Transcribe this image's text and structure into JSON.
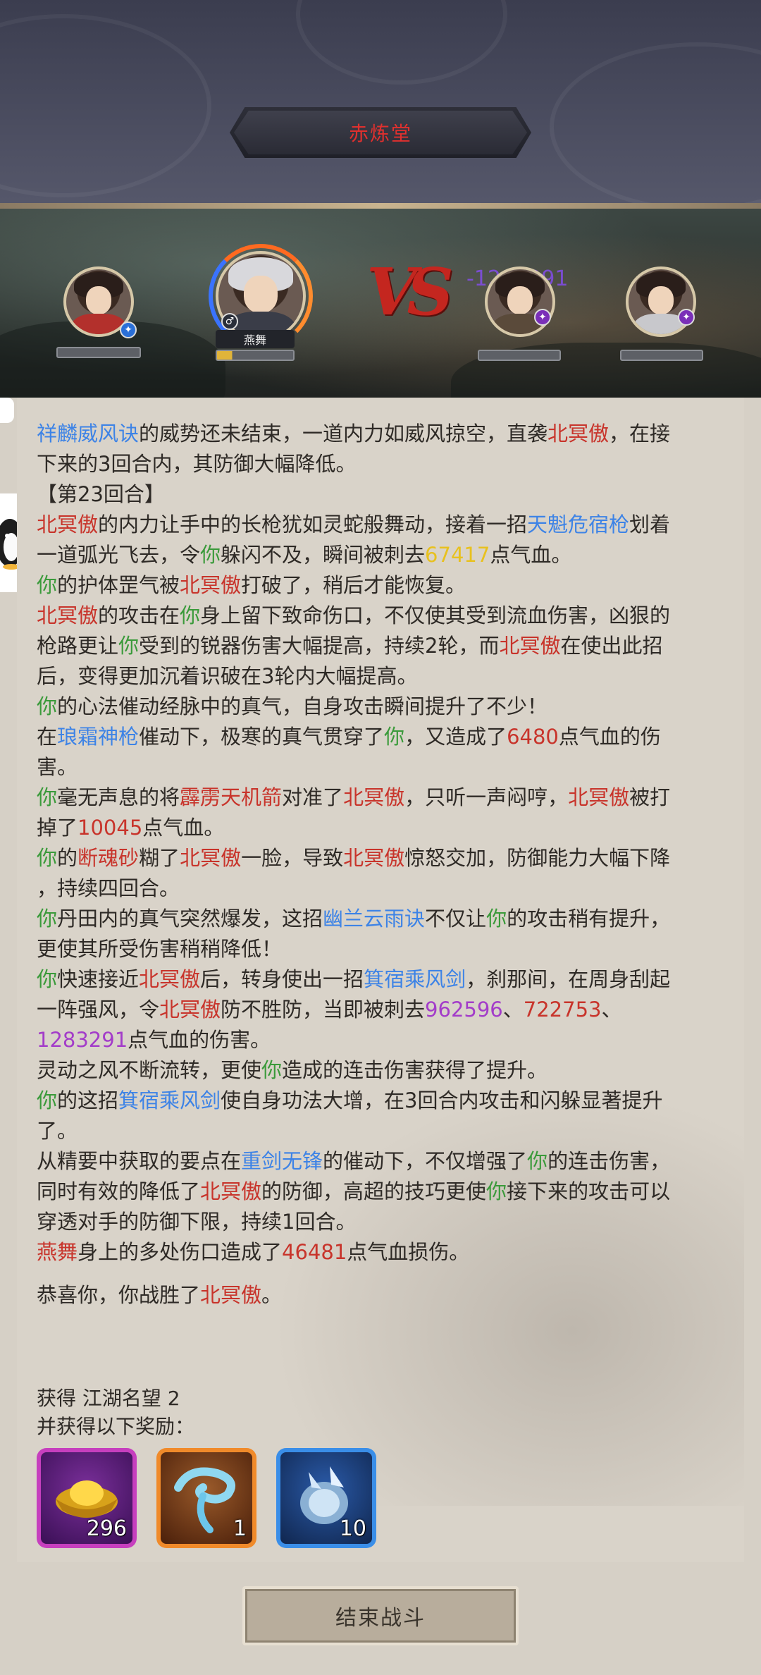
{
  "header": {
    "title": "赤炼堂"
  },
  "battle": {
    "player_name_tag": "燕舞",
    "floating_damage": "-1283291",
    "vs_text": "VS"
  },
  "log": [
    [
      {
        "t": "祥麟威风诀",
        "c": "blue"
      },
      {
        "t": "的威势还未结束，一道内力如威风掠空，直袭"
      },
      {
        "t": "北冥傲",
        "c": "red"
      },
      {
        "t": "，在接"
      }
    ],
    [
      {
        "t": "下来的3回合内，其防御大幅降低。"
      }
    ],
    [
      {
        "t": "【第23回合】"
      }
    ],
    [
      {
        "t": "北冥傲",
        "c": "red"
      },
      {
        "t": "的内力让手中的长枪犹如灵蛇般舞动，接着一招"
      },
      {
        "t": "天魁危宿枪",
        "c": "blue"
      },
      {
        "t": "划着"
      }
    ],
    [
      {
        "t": "一道弧光飞去，令"
      },
      {
        "t": "你",
        "c": "green"
      },
      {
        "t": "躲闪不及，瞬间被刺去"
      },
      {
        "t": "67417",
        "c": "yellow"
      },
      {
        "t": "点气血。"
      }
    ],
    [
      {
        "t": "你",
        "c": "green"
      },
      {
        "t": "的护体罡气被"
      },
      {
        "t": "北冥傲",
        "c": "red"
      },
      {
        "t": "打破了，稍后才能恢复。"
      }
    ],
    [
      {
        "t": "北冥傲",
        "c": "red"
      },
      {
        "t": "的攻击在"
      },
      {
        "t": "你",
        "c": "green"
      },
      {
        "t": "身上留下致命伤口，不仅使其受到流血伤害，凶狠的"
      }
    ],
    [
      {
        "t": "枪路更让"
      },
      {
        "t": "你",
        "c": "green"
      },
      {
        "t": "受到的锐器伤害大幅提高，持续2轮，而"
      },
      {
        "t": "北冥傲",
        "c": "red"
      },
      {
        "t": "在使出此招"
      }
    ],
    [
      {
        "t": "后，变得更加沉着识破在3轮内大幅提高。"
      }
    ],
    [
      {
        "t": "你",
        "c": "green"
      },
      {
        "t": "的心法催动经脉中的真气，自身攻击瞬间提升了不少！"
      }
    ],
    [
      {
        "t": "在"
      },
      {
        "t": "琅霜神枪",
        "c": "blue"
      },
      {
        "t": "催动下，极寒的真气贯穿了"
      },
      {
        "t": "你",
        "c": "green"
      },
      {
        "t": "，又造成了"
      },
      {
        "t": "6480",
        "c": "red"
      },
      {
        "t": "点气血的伤"
      }
    ],
    [
      {
        "t": "害。"
      }
    ],
    [
      {
        "t": "你",
        "c": "green"
      },
      {
        "t": "毫无声息的将"
      },
      {
        "t": "霹雳天机箭",
        "c": "red"
      },
      {
        "t": "对准了"
      },
      {
        "t": "北冥傲",
        "c": "red"
      },
      {
        "t": "，只听一声闷哼，"
      },
      {
        "t": "北冥傲",
        "c": "red"
      },
      {
        "t": "被打"
      }
    ],
    [
      {
        "t": "掉了"
      },
      {
        "t": "10045",
        "c": "red"
      },
      {
        "t": "点气血。"
      }
    ],
    [
      {
        "t": "你",
        "c": "green"
      },
      {
        "t": "的"
      },
      {
        "t": "断魂砂",
        "c": "red"
      },
      {
        "t": "糊了"
      },
      {
        "t": "北冥傲",
        "c": "red"
      },
      {
        "t": "一脸，导致"
      },
      {
        "t": "北冥傲",
        "c": "red"
      },
      {
        "t": "惊怒交加，防御能力大幅下降"
      }
    ],
    [
      {
        "t": "，持续四回合。"
      }
    ],
    [
      {
        "t": "你",
        "c": "green"
      },
      {
        "t": "丹田内的真气突然爆发，这招"
      },
      {
        "t": "幽兰云雨诀",
        "c": "blue"
      },
      {
        "t": "不仅让"
      },
      {
        "t": "你",
        "c": "green"
      },
      {
        "t": "的攻击稍有提升，"
      }
    ],
    [
      {
        "t": "更使其所受伤害稍稍降低！"
      }
    ],
    [
      {
        "t": "你",
        "c": "green"
      },
      {
        "t": "快速接近"
      },
      {
        "t": "北冥傲",
        "c": "red"
      },
      {
        "t": "后，转身使出一招"
      },
      {
        "t": "箕宿乘风剑",
        "c": "blue"
      },
      {
        "t": "，刹那间，在周身刮起"
      }
    ],
    [
      {
        "t": "一阵强风，令"
      },
      {
        "t": "北冥傲",
        "c": "red"
      },
      {
        "t": "防不胜防，当即被刺去"
      },
      {
        "t": "962596",
        "c": "purple"
      },
      {
        "t": "、"
      },
      {
        "t": "722753",
        "c": "red"
      },
      {
        "t": "、"
      }
    ],
    [
      {
        "t": "1283291",
        "c": "purple"
      },
      {
        "t": "点气血的伤害。"
      }
    ],
    [
      {
        "t": "灵动之风不断流转，更使"
      },
      {
        "t": "你",
        "c": "green"
      },
      {
        "t": "造成的连击伤害获得了提升。"
      }
    ],
    [
      {
        "t": "你",
        "c": "green"
      },
      {
        "t": "的这招"
      },
      {
        "t": "箕宿乘风剑",
        "c": "blue"
      },
      {
        "t": "使自身功法大增，在3回合内攻击和闪躲显著提升"
      }
    ],
    [
      {
        "t": "了。"
      }
    ],
    [
      {
        "t": "从精要中获取的要点在"
      },
      {
        "t": "重剑无锋",
        "c": "blue"
      },
      {
        "t": "的催动下，不仅增强了"
      },
      {
        "t": "你",
        "c": "green"
      },
      {
        "t": "的连击伤害，"
      }
    ],
    [
      {
        "t": "同时有效的降低了"
      },
      {
        "t": "北冥傲",
        "c": "red"
      },
      {
        "t": "的防御，高超的技巧更使"
      },
      {
        "t": "你",
        "c": "green"
      },
      {
        "t": "接下来的攻击可以"
      }
    ],
    [
      {
        "t": "穿透对手的防御下限，持续1回合。"
      }
    ],
    [
      {
        "t": "燕舞",
        "c": "red"
      },
      {
        "t": "身上的多处伤口造成了"
      },
      {
        "t": "46481",
        "c": "red"
      },
      {
        "t": "点气血损伤。"
      }
    ],
    [],
    [
      {
        "t": "恭喜你，你战胜了"
      },
      {
        "t": "北冥傲",
        "c": "red"
      },
      {
        "t": "。"
      }
    ]
  ],
  "rewards": {
    "reputation_label": "获得 江湖名望 2",
    "items_label": "并获得以下奖励：",
    "items": [
      {
        "icon": "gold-ingot-icon",
        "count": "296"
      },
      {
        "icon": "cloud-scroll-icon",
        "count": "1"
      },
      {
        "icon": "feather-gem-icon",
        "count": "10"
      }
    ]
  },
  "footer": {
    "end_button": "结束战斗"
  }
}
